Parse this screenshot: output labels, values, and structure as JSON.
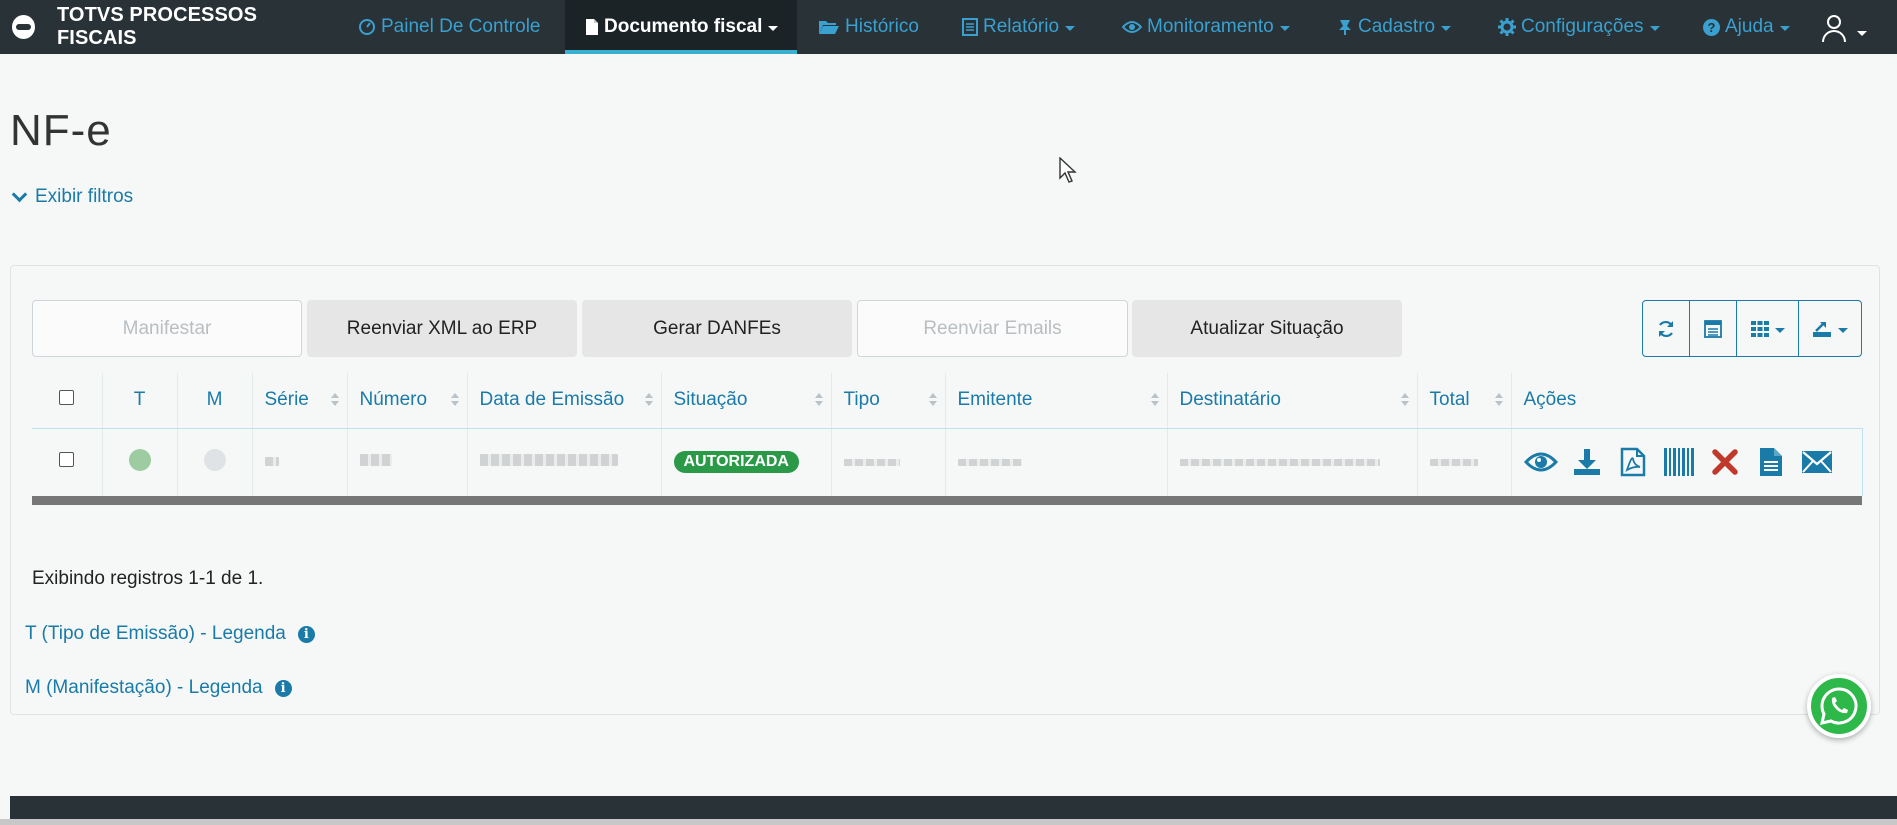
{
  "brand": {
    "name": "TOTVS PROCESSOS FISCAIS"
  },
  "nav": {
    "items": [
      {
        "label": "Painel De Controle",
        "icon": "dashboard-icon"
      },
      {
        "label": "Documento fiscal",
        "icon": "file-icon",
        "active": true
      },
      {
        "label": "Histórico",
        "icon": "folder-open-icon"
      },
      {
        "label": "Relatório",
        "icon": "list-icon"
      },
      {
        "label": "Monitoramento",
        "icon": "eye-icon"
      },
      {
        "label": "Cadastro",
        "icon": "pin-icon"
      },
      {
        "label": "Configurações",
        "icon": "gear-icon"
      },
      {
        "label": "Ajuda",
        "icon": "question-circle-icon"
      }
    ]
  },
  "page": {
    "title": "NF-e",
    "filters_label": "Exibir filtros"
  },
  "toolbar": {
    "manifestar": "Manifestar",
    "reenviar_xml": "Reenviar XML ao ERP",
    "gerar_danfes": "Gerar DANFEs",
    "reenviar_emails": "Reenviar Emails",
    "atualizar_situacao": "Atualizar Situação"
  },
  "table": {
    "headers": {
      "t": "T",
      "m": "M",
      "serie": "Série",
      "numero": "Número",
      "data_emissao": "Data de Emissão",
      "situacao": "Situação",
      "tipo": "Tipo",
      "emitente": "Emitente",
      "destinatario": "Destinatário",
      "total": "Total",
      "acoes": "Ações"
    },
    "rows": [
      {
        "situacao": "AUTORIZADA",
        "t_color": "#9ccc9f",
        "m_color": "#dfe3e5"
      }
    ]
  },
  "records_info": "Exibindo registros 1-1 de 1.",
  "legends": {
    "t": "T (Tipo de Emissão) - Legenda",
    "m": "M (Manifestação) - Legenda"
  },
  "colors": {
    "navbar": "#283237",
    "accent": "#1a7aa8",
    "nav_link": "#3aa0d0",
    "success": "#2a9a48",
    "error": "#c0392b"
  }
}
